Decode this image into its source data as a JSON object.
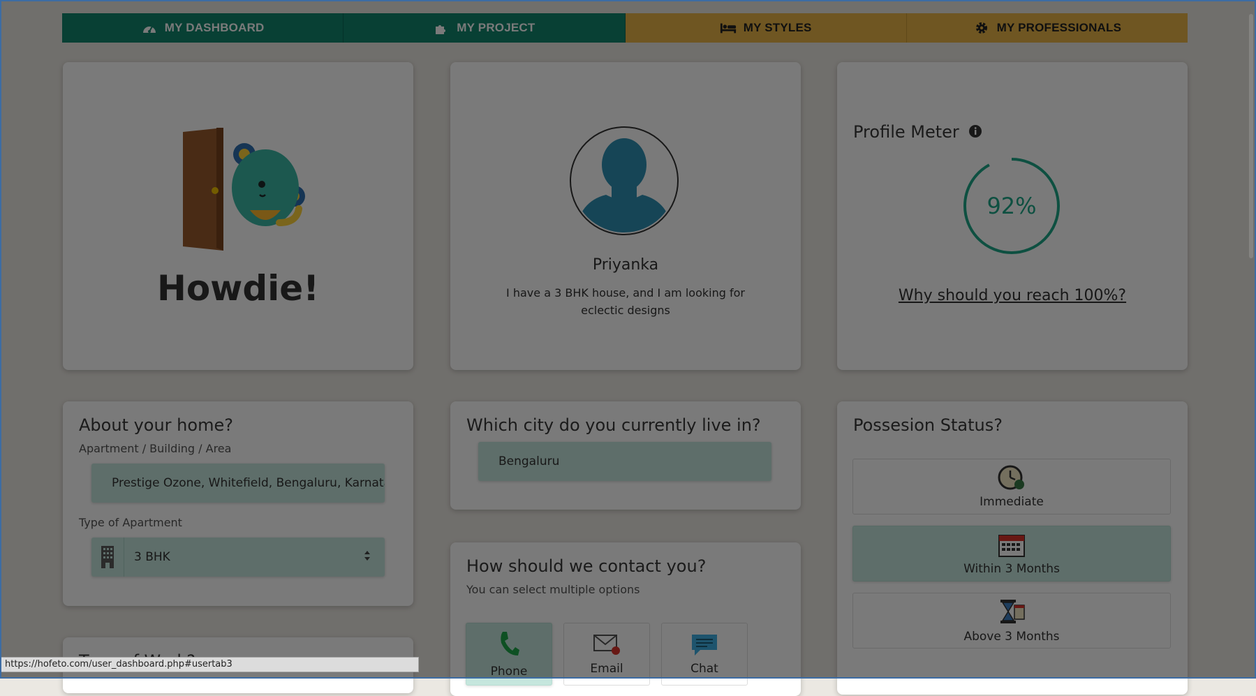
{
  "nav": {
    "tabs": [
      {
        "label": "MY DASHBOARD",
        "icon": "dashboard-icon"
      },
      {
        "label": "MY PROJECT",
        "icon": "puzzle-icon"
      },
      {
        "label": "MY STYLES",
        "icon": "bed-icon"
      },
      {
        "label": "MY PROFESSIONALS",
        "icon": "gear-icon"
      }
    ]
  },
  "welcome": {
    "heading": "Howdie!"
  },
  "profile": {
    "name": "Priyanka",
    "bio": "I have a 3 BHK house, and I am looking for eclectic designs"
  },
  "meter": {
    "title": "Profile Meter",
    "percent_label": "92%",
    "percent_value": 92,
    "link": "Why should you reach 100%?"
  },
  "home": {
    "title": "About your home?",
    "address_label": "Apartment / Building / Area",
    "address_value": "Prestige Ozone, Whitefield, Bengaluru, Karnataka",
    "type_label": "Type of Apartment",
    "type_value": "3 BHK"
  },
  "next_card": {
    "title": "Type of Work?"
  },
  "city": {
    "title": "Which city do you currently live in?",
    "value": "Bengaluru"
  },
  "contact": {
    "title": "How should we contact you?",
    "subtitle": "You can select multiple options",
    "options": [
      {
        "label": "Phone",
        "icon": "phone-icon",
        "selected": true
      },
      {
        "label": "Email",
        "icon": "email-icon",
        "selected": false
      },
      {
        "label": "Chat",
        "icon": "chat-icon",
        "selected": false
      }
    ]
  },
  "possession": {
    "title": "Possesion Status?",
    "options": [
      {
        "label": "Immediate",
        "icon": "clock-icon",
        "selected": false
      },
      {
        "label": "Within 3 Months",
        "icon": "calendar-icon",
        "selected": true
      },
      {
        "label": "Above 3 Months",
        "icon": "hourglass-icon",
        "selected": false
      }
    ]
  },
  "status_bar": {
    "url": "https://hofeto.com/user_dashboard.php#usertab3"
  },
  "colors": {
    "green": "#11866d",
    "gold": "#e9b547",
    "field": "#c5e6dd"
  }
}
